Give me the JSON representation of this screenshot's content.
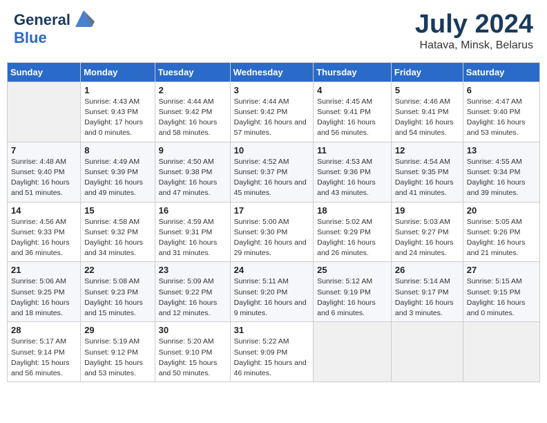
{
  "header": {
    "logo_line1": "General",
    "logo_line2": "Blue",
    "month_year": "July 2024",
    "location": "Hatava, Minsk, Belarus"
  },
  "days_of_week": [
    "Sunday",
    "Monday",
    "Tuesday",
    "Wednesday",
    "Thursday",
    "Friday",
    "Saturday"
  ],
  "weeks": [
    [
      {
        "day": "",
        "sunrise": "",
        "sunset": "",
        "daylight": ""
      },
      {
        "day": "1",
        "sunrise": "Sunrise: 4:43 AM",
        "sunset": "Sunset: 9:43 PM",
        "daylight": "Daylight: 17 hours and 0 minutes."
      },
      {
        "day": "2",
        "sunrise": "Sunrise: 4:44 AM",
        "sunset": "Sunset: 9:42 PM",
        "daylight": "Daylight: 16 hours and 58 minutes."
      },
      {
        "day": "3",
        "sunrise": "Sunrise: 4:44 AM",
        "sunset": "Sunset: 9:42 PM",
        "daylight": "Daylight: 16 hours and 57 minutes."
      },
      {
        "day": "4",
        "sunrise": "Sunrise: 4:45 AM",
        "sunset": "Sunset: 9:41 PM",
        "daylight": "Daylight: 16 hours and 56 minutes."
      },
      {
        "day": "5",
        "sunrise": "Sunrise: 4:46 AM",
        "sunset": "Sunset: 9:41 PM",
        "daylight": "Daylight: 16 hours and 54 minutes."
      },
      {
        "day": "6",
        "sunrise": "Sunrise: 4:47 AM",
        "sunset": "Sunset: 9:40 PM",
        "daylight": "Daylight: 16 hours and 53 minutes."
      }
    ],
    [
      {
        "day": "7",
        "sunrise": "Sunrise: 4:48 AM",
        "sunset": "Sunset: 9:40 PM",
        "daylight": "Daylight: 16 hours and 51 minutes."
      },
      {
        "day": "8",
        "sunrise": "Sunrise: 4:49 AM",
        "sunset": "Sunset: 9:39 PM",
        "daylight": "Daylight: 16 hours and 49 minutes."
      },
      {
        "day": "9",
        "sunrise": "Sunrise: 4:50 AM",
        "sunset": "Sunset: 9:38 PM",
        "daylight": "Daylight: 16 hours and 47 minutes."
      },
      {
        "day": "10",
        "sunrise": "Sunrise: 4:52 AM",
        "sunset": "Sunset: 9:37 PM",
        "daylight": "Daylight: 16 hours and 45 minutes."
      },
      {
        "day": "11",
        "sunrise": "Sunrise: 4:53 AM",
        "sunset": "Sunset: 9:36 PM",
        "daylight": "Daylight: 16 hours and 43 minutes."
      },
      {
        "day": "12",
        "sunrise": "Sunrise: 4:54 AM",
        "sunset": "Sunset: 9:35 PM",
        "daylight": "Daylight: 16 hours and 41 minutes."
      },
      {
        "day": "13",
        "sunrise": "Sunrise: 4:55 AM",
        "sunset": "Sunset: 9:34 PM",
        "daylight": "Daylight: 16 hours and 39 minutes."
      }
    ],
    [
      {
        "day": "14",
        "sunrise": "Sunrise: 4:56 AM",
        "sunset": "Sunset: 9:33 PM",
        "daylight": "Daylight: 16 hours and 36 minutes."
      },
      {
        "day": "15",
        "sunrise": "Sunrise: 4:58 AM",
        "sunset": "Sunset: 9:32 PM",
        "daylight": "Daylight: 16 hours and 34 minutes."
      },
      {
        "day": "16",
        "sunrise": "Sunrise: 4:59 AM",
        "sunset": "Sunset: 9:31 PM",
        "daylight": "Daylight: 16 hours and 31 minutes."
      },
      {
        "day": "17",
        "sunrise": "Sunrise: 5:00 AM",
        "sunset": "Sunset: 9:30 PM",
        "daylight": "Daylight: 16 hours and 29 minutes."
      },
      {
        "day": "18",
        "sunrise": "Sunrise: 5:02 AM",
        "sunset": "Sunset: 9:29 PM",
        "daylight": "Daylight: 16 hours and 26 minutes."
      },
      {
        "day": "19",
        "sunrise": "Sunrise: 5:03 AM",
        "sunset": "Sunset: 9:27 PM",
        "daylight": "Daylight: 16 hours and 24 minutes."
      },
      {
        "day": "20",
        "sunrise": "Sunrise: 5:05 AM",
        "sunset": "Sunset: 9:26 PM",
        "daylight": "Daylight: 16 hours and 21 minutes."
      }
    ],
    [
      {
        "day": "21",
        "sunrise": "Sunrise: 5:06 AM",
        "sunset": "Sunset: 9:25 PM",
        "daylight": "Daylight: 16 hours and 18 minutes."
      },
      {
        "day": "22",
        "sunrise": "Sunrise: 5:08 AM",
        "sunset": "Sunset: 9:23 PM",
        "daylight": "Daylight: 16 hours and 15 minutes."
      },
      {
        "day": "23",
        "sunrise": "Sunrise: 5:09 AM",
        "sunset": "Sunset: 9:22 PM",
        "daylight": "Daylight: 16 hours and 12 minutes."
      },
      {
        "day": "24",
        "sunrise": "Sunrise: 5:11 AM",
        "sunset": "Sunset: 9:20 PM",
        "daylight": "Daylight: 16 hours and 9 minutes."
      },
      {
        "day": "25",
        "sunrise": "Sunrise: 5:12 AM",
        "sunset": "Sunset: 9:19 PM",
        "daylight": "Daylight: 16 hours and 6 minutes."
      },
      {
        "day": "26",
        "sunrise": "Sunrise: 5:14 AM",
        "sunset": "Sunset: 9:17 PM",
        "daylight": "Daylight: 16 hours and 3 minutes."
      },
      {
        "day": "27",
        "sunrise": "Sunrise: 5:15 AM",
        "sunset": "Sunset: 9:15 PM",
        "daylight": "Daylight: 16 hours and 0 minutes."
      }
    ],
    [
      {
        "day": "28",
        "sunrise": "Sunrise: 5:17 AM",
        "sunset": "Sunset: 9:14 PM",
        "daylight": "Daylight: 15 hours and 56 minutes."
      },
      {
        "day": "29",
        "sunrise": "Sunrise: 5:19 AM",
        "sunset": "Sunset: 9:12 PM",
        "daylight": "Daylight: 15 hours and 53 minutes."
      },
      {
        "day": "30",
        "sunrise": "Sunrise: 5:20 AM",
        "sunset": "Sunset: 9:10 PM",
        "daylight": "Daylight: 15 hours and 50 minutes."
      },
      {
        "day": "31",
        "sunrise": "Sunrise: 5:22 AM",
        "sunset": "Sunset: 9:09 PM",
        "daylight": "Daylight: 15 hours and 46 minutes."
      },
      {
        "day": "",
        "sunrise": "",
        "sunset": "",
        "daylight": ""
      },
      {
        "day": "",
        "sunrise": "",
        "sunset": "",
        "daylight": ""
      },
      {
        "day": "",
        "sunrise": "",
        "sunset": "",
        "daylight": ""
      }
    ]
  ]
}
